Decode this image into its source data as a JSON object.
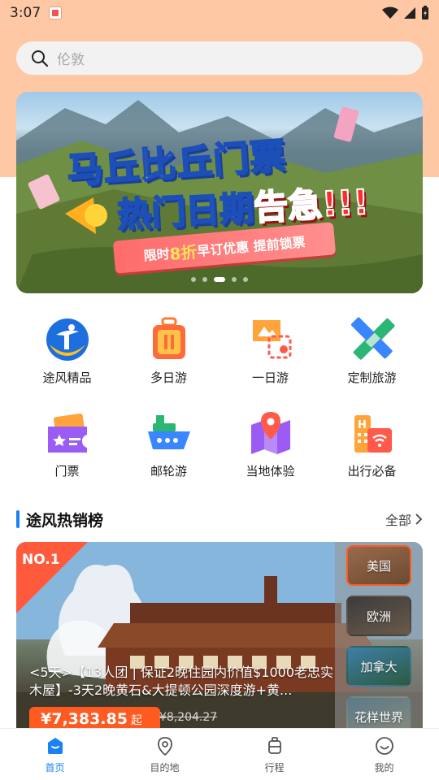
{
  "status_bar": {
    "time": "3:07"
  },
  "search": {
    "placeholder": "伦敦"
  },
  "banner": {
    "title_line1": "马丘比丘门票",
    "title_line2_a": "热门日期",
    "title_line2_b": "告急!!!",
    "ribbon_a": "限时",
    "ribbon_b": "8折",
    "ribbon_c": "早订优惠 提前锁票",
    "slide_count": 5,
    "active_slide": 2
  },
  "categories": [
    {
      "label": "途风精品",
      "icon": "tufeng-logo-icon"
    },
    {
      "label": "多日游",
      "icon": "suitcase-icon"
    },
    {
      "label": "一日游",
      "icon": "flag-ticket-icon"
    },
    {
      "label": "定制旅游",
      "icon": "ruler-pencil-icon"
    },
    {
      "label": "门票",
      "icon": "ticket-icon"
    },
    {
      "label": "邮轮游",
      "icon": "cruise-ship-icon"
    },
    {
      "label": "当地体验",
      "icon": "map-pin-icon"
    },
    {
      "label": "出行必备",
      "icon": "hotel-wifi-icon"
    }
  ],
  "hot_section": {
    "title": "途风热销榜",
    "more_label": "全部",
    "rank": "NO.1",
    "product_title": "<5天>【13人团 | 保证2晚住园内价值$1000老忠实木屋】-3天2晚黄石&大提顿公园深度游+黄...",
    "price": "¥7,383.85",
    "price_suffix": "起",
    "original_price": "¥8,204.27",
    "regions": [
      "美国",
      "欧洲",
      "加拿大",
      "花样世界"
    ],
    "active_region": 0
  },
  "bottom_nav": {
    "items": [
      "首页",
      "目的地",
      "行程",
      "我的"
    ],
    "active": 0
  },
  "colors": {
    "accent": "#1a82f4",
    "header_bg": "#ffc8a4",
    "price": "#ff5a1f"
  }
}
